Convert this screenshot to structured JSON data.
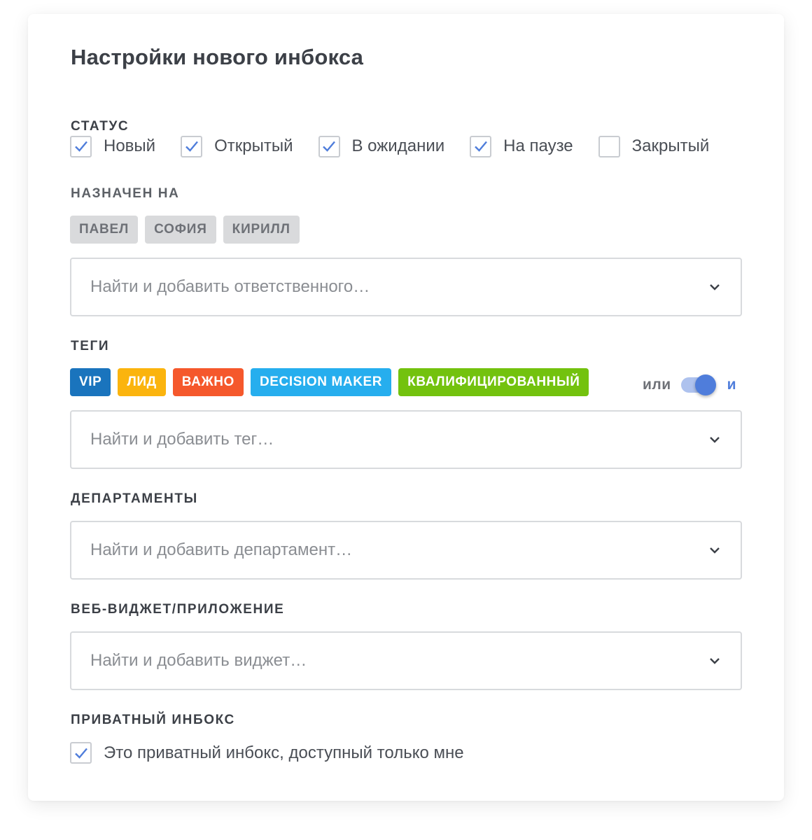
{
  "title": "Настройки нового инбокса",
  "status": {
    "label": "Статус",
    "options": [
      {
        "label": "Новый",
        "checked": true
      },
      {
        "label": "Открытый",
        "checked": true
      },
      {
        "label": "В ожидании",
        "checked": true
      },
      {
        "label": "На паузе",
        "checked": true
      },
      {
        "label": "Закрытый",
        "checked": false
      }
    ]
  },
  "assignee": {
    "label": "Назначен на",
    "chips": [
      "Павел",
      "София",
      "Кирилл"
    ],
    "placeholder": "Найти и добавить ответственного…"
  },
  "tags": {
    "label": "Теги",
    "chips": [
      {
        "label": "VIP",
        "color": "#1a74bd"
      },
      {
        "label": "Лид",
        "color": "#fbb40e"
      },
      {
        "label": "Важно",
        "color": "#f5582c"
      },
      {
        "label": "Decision maker",
        "color": "#26aeee"
      },
      {
        "label": "Квалифицированный",
        "color": "#73c20e"
      }
    ],
    "toggle": {
      "left_label": "или",
      "right_label": "и",
      "value": "и"
    },
    "placeholder": "Найти и добавить тег…"
  },
  "departments": {
    "label": "Департаменты",
    "placeholder": "Найти и добавить департамент…"
  },
  "widget": {
    "label": "Веб-виджет/приложение",
    "placeholder": "Найти и добавить виджет…"
  },
  "private": {
    "label": "Приватный инбокс",
    "checkbox_label": "Это приватный инбокс, доступный только мне",
    "checked": true
  },
  "icons": {
    "check": "check-icon",
    "chevron": "chevron-down-icon"
  },
  "colors": {
    "accent": "#4f7ddb",
    "text": "#3c4047",
    "border": "#d8dadd"
  }
}
